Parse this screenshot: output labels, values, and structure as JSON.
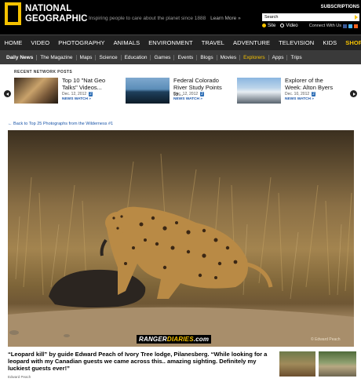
{
  "header": {
    "logo_line1": "NATIONAL",
    "logo_line2": "GEOGRAPHIC",
    "tagline": "Inspiring people to care about the planet since 1888",
    "learn_more": "Learn More »",
    "subscriptions": "SUBSCRIPTIONS",
    "search_placeholder": "Search",
    "search_option_site": "Site",
    "search_option_video": "Video",
    "connect_label": "Connect With Us"
  },
  "main_nav": [
    "HOME",
    "VIDEO",
    "PHOTOGRAPHY",
    "ANIMALS",
    "ENVIRONMENT",
    "TRAVEL",
    "ADVENTURE",
    "TELEVISION",
    "KIDS",
    "SHOP"
  ],
  "sub_nav": [
    "Daily News",
    "The Magazine",
    "Maps",
    "Science",
    "Education",
    "Games",
    "Events",
    "Blogs",
    "Movies",
    "Explorers",
    "Apps",
    "Trips"
  ],
  "recent": {
    "heading": "RECENT NETWORK POSTS",
    "posts": [
      {
        "title": "Top 10 \"Nat Geo Talks\" Videos...",
        "date": "Dec. 12, 2012",
        "comments": "2",
        "source": "NEWS WATCH »"
      },
      {
        "title": "Federal Colorado River Study Points to...",
        "date": "Dec. 12, 2012",
        "comments": "2",
        "source": "NEWS WATCH »"
      },
      {
        "title": "Explorer of the Week: Alton Byers",
        "date": "Dec. 10, 2012",
        "comments": "2",
        "source": "NEWS WATCH »"
      }
    ]
  },
  "back_link": "← Back to Top 25 Photographs from the Wilderness #1",
  "photo": {
    "watermark_a": "RANGER",
    "watermark_b": "DIARIES",
    "watermark_c": ".com",
    "copyright": "© Edward Peach"
  },
  "caption": "“Leopard kill” by guide Edward Peach of Ivory Tree lodge, Pilanesberg. “While looking for a leopard with my Canadian guests we came across this.. amazing sighting. Definitely my luckiest guests ever!”",
  "credit": "Edward Peach"
}
